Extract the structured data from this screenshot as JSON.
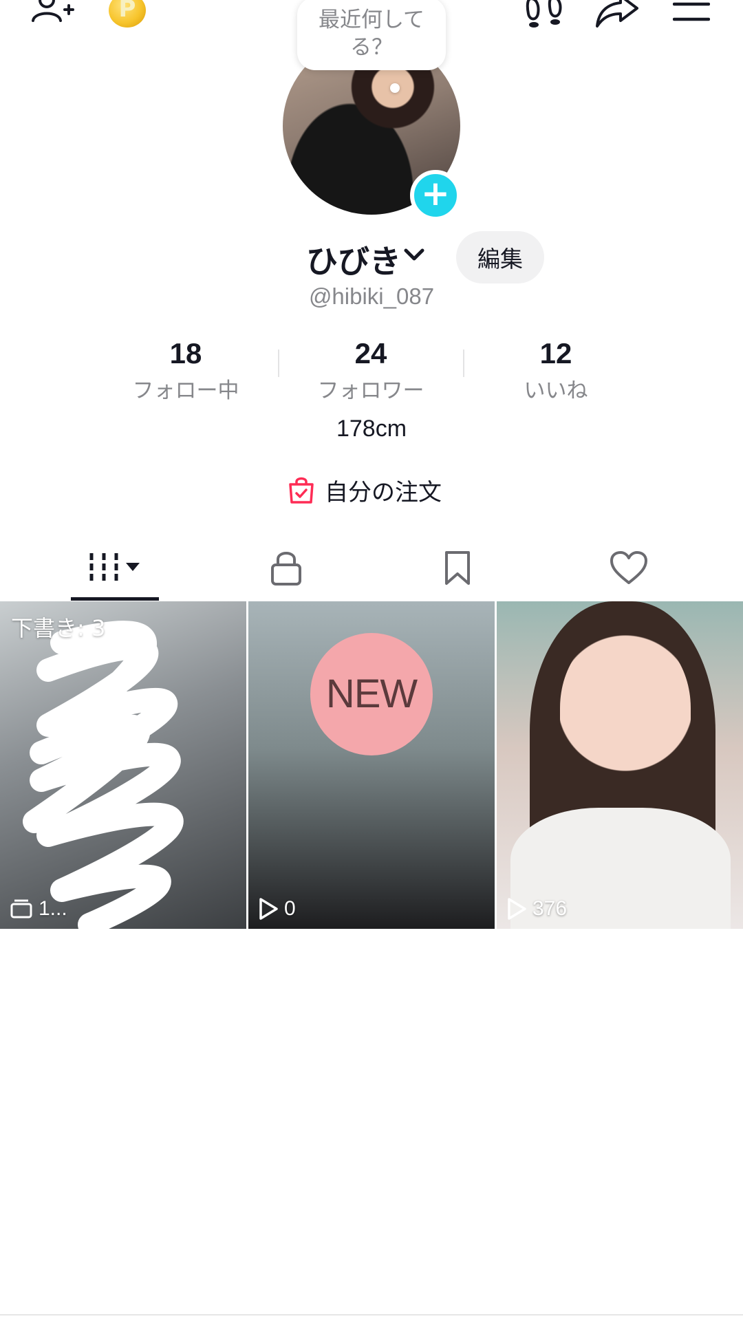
{
  "status_bubble": {
    "text": "最近何してる？"
  },
  "profile": {
    "nickname": "ひびき",
    "edit_label": "編集",
    "username": "@hibiki_087",
    "bio": "178cm"
  },
  "coin": {
    "symbol": "P"
  },
  "stats": [
    {
      "value": "18",
      "label": "フォロー中"
    },
    {
      "value": "24",
      "label": "フォロワー"
    },
    {
      "value": "12",
      "label": "いいね"
    }
  ],
  "orders": {
    "label": "自分の注文"
  },
  "tabs": [
    {
      "name": "videos",
      "icon": "grid-icon",
      "active": true
    },
    {
      "name": "private",
      "icon": "lock-icon"
    },
    {
      "name": "saved",
      "icon": "bookmark-icon"
    },
    {
      "name": "liked",
      "icon": "heart-icon"
    }
  ],
  "grid": [
    {
      "overlay": "下書き: 3",
      "count": "1..."
    },
    {
      "badge": "NEW",
      "count": "0"
    },
    {
      "count": "376"
    }
  ],
  "colors": {
    "accent": "#20d5ec",
    "coin": "#f7c52d",
    "new_badge": "#f4a7ab",
    "orders_icon": "#fe2c55"
  }
}
